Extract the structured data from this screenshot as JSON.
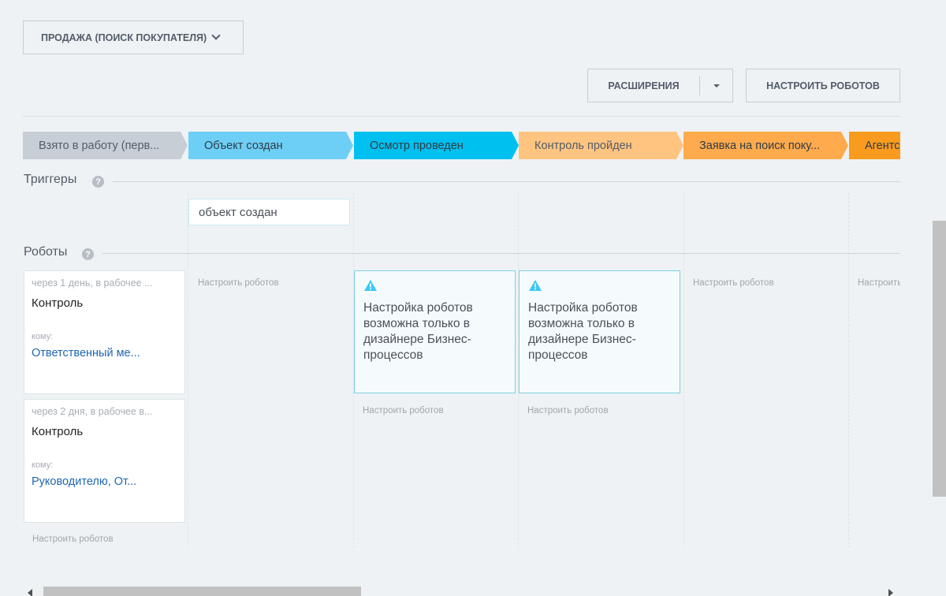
{
  "pipeline": {
    "label": "ПРОДАЖА (ПОИСК ПОКУПАТЕЛЯ)",
    "icon": "chevron-down-icon"
  },
  "toolbar": {
    "extensions_label": "РАСШИРЕНИЯ",
    "setup_robots_label": "НАСТРОИТЬ РОБОТОВ"
  },
  "stages": [
    {
      "label": "Взято в работу (перв...",
      "color": "#c8ced5",
      "text_color": "#535c69"
    },
    {
      "label": "Объект создан",
      "color": "#6ecff6",
      "text_color": "#2e3b46"
    },
    {
      "label": "Осмотр проведен",
      "color": "#00c0ef",
      "text_color": "#2e3b46"
    },
    {
      "label": "Контроль пройден",
      "color": "#ffc480",
      "text_color": "#535c69"
    },
    {
      "label": "Заявка на поиск поку...",
      "color": "#ffaa4c",
      "text_color": "#2e3b46"
    },
    {
      "label": "Агентс...",
      "color": "#f99b1e",
      "text_color": "#2e3b46"
    }
  ],
  "triggers": {
    "title": "Триггеры",
    "items": [
      {
        "label": "объект создан"
      }
    ]
  },
  "robots": {
    "title": "Роботы",
    "cards": [
      {
        "delay": "через 1 день, в рабочее ...",
        "title": "Контроль",
        "to_label": "кому:",
        "to_value": "Ответственный ме..."
      },
      {
        "delay": "через 2 дня, в рабочее в...",
        "title": "Контроль",
        "to_label": "кому:",
        "to_value": "Руководителю, От..."
      }
    ],
    "warning_text": "Настройка роботов возможна только в дизайнере Бизнес-процессов",
    "setup_link": "Настроить роботов",
    "setup_link_cut": "Настроить"
  },
  "colors": {
    "link": "#2067b0",
    "warning_border": "#7fcfe0",
    "warning_icon": "#3bc8f5"
  }
}
